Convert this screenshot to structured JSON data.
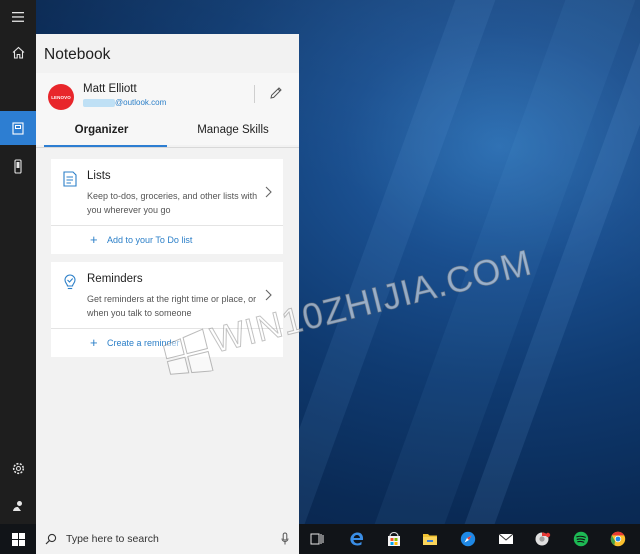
{
  "panel": {
    "title": "Notebook",
    "profile": {
      "avatar_text": "LENOVO",
      "name": "Matt Elliott",
      "email": "@outlook.com"
    },
    "tabs": [
      {
        "label": "Organizer",
        "active": true
      },
      {
        "label": "Manage Skills",
        "active": false
      }
    ],
    "cards": [
      {
        "title": "Lists",
        "description": "Keep to-dos, groceries, and other lists with you wherever you go",
        "action": "Add to your To Do list",
        "icon": "list-icon"
      },
      {
        "title": "Reminders",
        "description": "Get reminders at the right time or place, or when you talk to someone",
        "action": "Create a reminder",
        "icon": "reminder-icon"
      }
    ]
  },
  "rail": {
    "items": [
      "hamburger-icon",
      "home-icon",
      "notebook-icon",
      "devices-icon",
      "settings-icon",
      "feedback-icon"
    ],
    "active": "notebook-icon"
  },
  "taskbar": {
    "search_placeholder": "Type here to search",
    "apps": [
      "task-view-icon",
      "edge-icon",
      "store-icon",
      "file-explorer-icon",
      "safari-icon",
      "mail-icon",
      "chrome-canary-icon",
      "spotify-icon",
      "chrome-icon"
    ]
  },
  "watermark": {
    "text": "WIN10ZHIJIA.COM"
  },
  "colors": {
    "accent": "#2d7ed2",
    "link": "#2b7fc8",
    "avatar": "#e8262b",
    "panel_bg": "#f2f2f2",
    "rail_bg": "#1e1e1e",
    "taskbar_bg": "#111418"
  }
}
